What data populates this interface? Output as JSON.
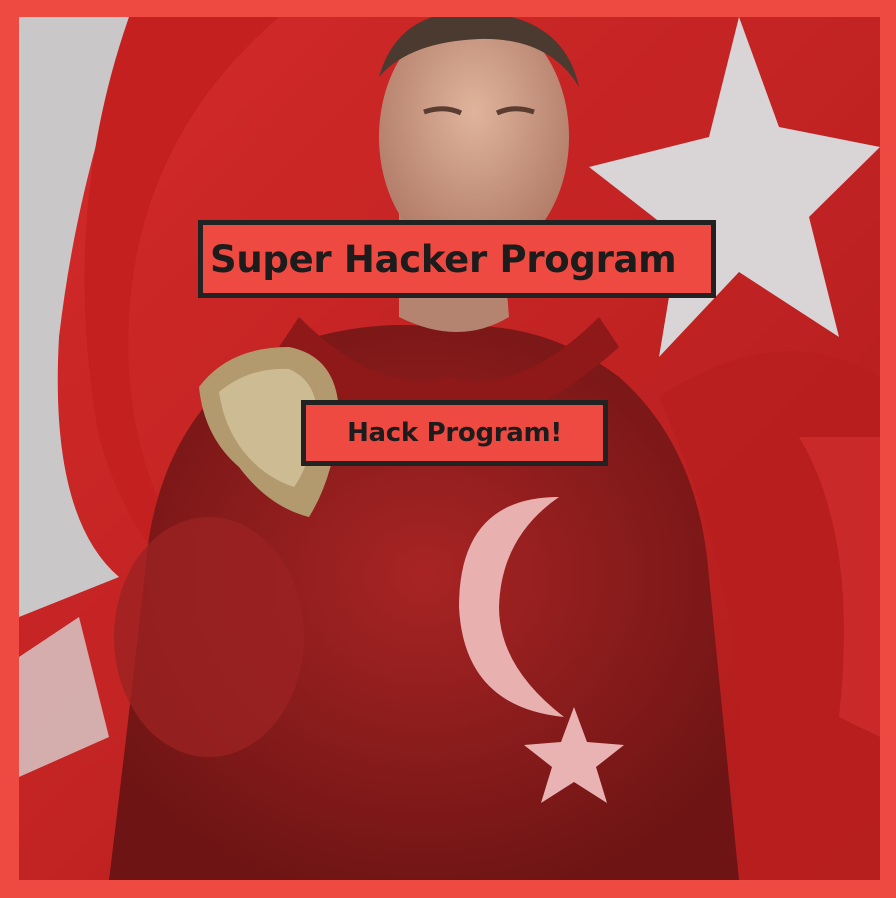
{
  "page": {
    "frame_color": "#ef4a42",
    "background_image": "flag-superhero-photo"
  },
  "title": {
    "text": "Super Hacker Program",
    "box_color": "#ef4a42",
    "border_color": "#222222"
  },
  "hack_button": {
    "label": "Hack Program!",
    "box_color": "#ef4a42",
    "border_color": "#222222"
  }
}
